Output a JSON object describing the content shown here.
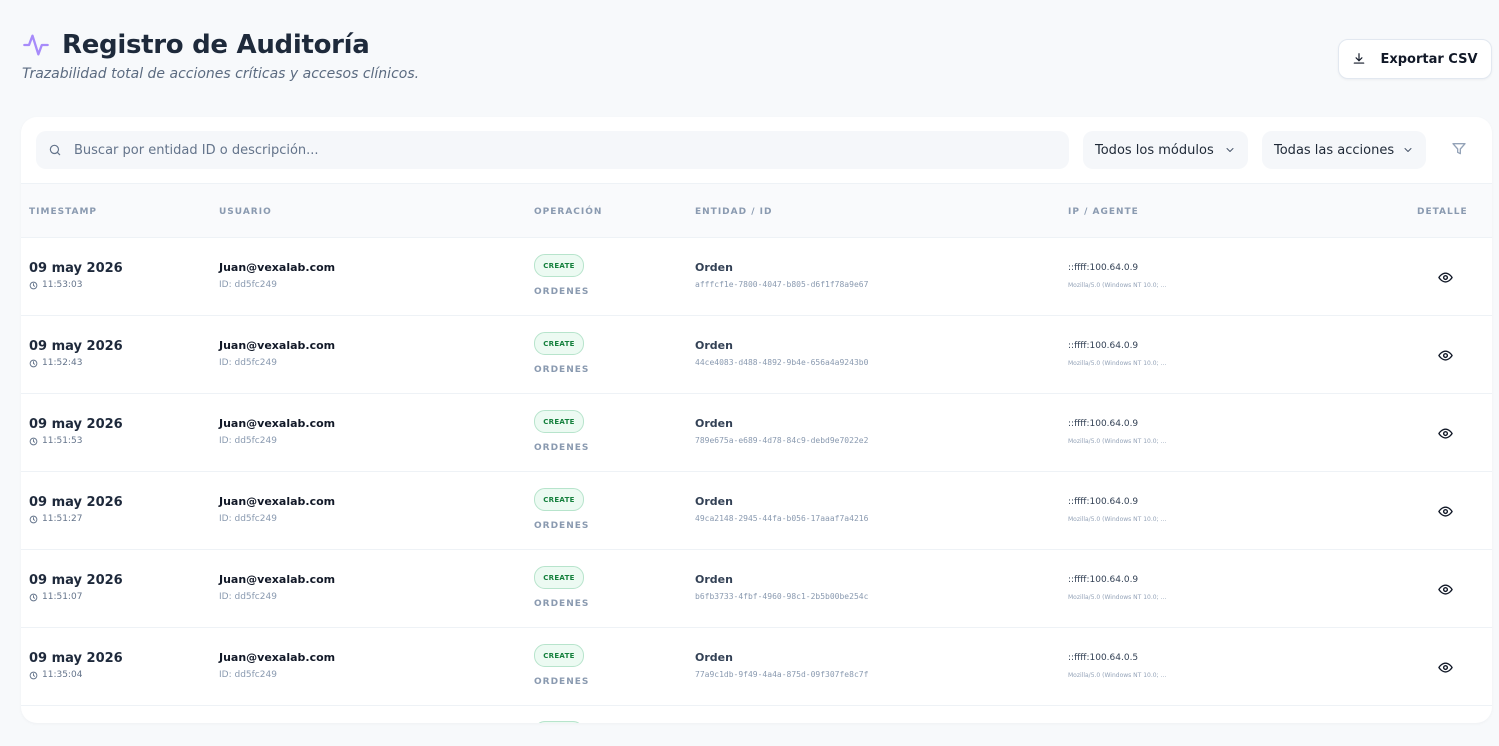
{
  "header": {
    "title": "Registro de Auditoría",
    "subtitle": "Trazabilidad total de acciones críticas y accesos clínicos.",
    "export_label": "Exportar CSV"
  },
  "toolbar": {
    "search_placeholder": "Buscar por entidad ID o descripción...",
    "module_filter": "Todos los módulos",
    "action_filter": "Todas las acciones"
  },
  "table": {
    "columns": {
      "timestamp": "TIMESTAMP",
      "user": "USUARIO",
      "operation": "OPERACIÓN",
      "entity": "ENTIDAD / ID",
      "ip": "IP / AGENTE",
      "detail": "DETALLE"
    },
    "rows": [
      {
        "date": "09 may 2026",
        "time": "11:53:03",
        "email": "Juan@vexalab.com",
        "user_id": "ID: dd5fc249",
        "operation": "CREATE",
        "module": "ORDENES",
        "entity": "Orden",
        "entity_id": "afffcf1e-7800-4047-b805-d6f1f78a9e67",
        "ip": "::ffff:100.64.0.9",
        "agent": "Mozilla/5.0 (Windows NT 10.0; ..."
      },
      {
        "date": "09 may 2026",
        "time": "11:52:43",
        "email": "Juan@vexalab.com",
        "user_id": "ID: dd5fc249",
        "operation": "CREATE",
        "module": "ORDENES",
        "entity": "Orden",
        "entity_id": "44ce4083-d488-4892-9b4e-656a4a9243b0",
        "ip": "::ffff:100.64.0.9",
        "agent": "Mozilla/5.0 (Windows NT 10.0; ..."
      },
      {
        "date": "09 may 2026",
        "time": "11:51:53",
        "email": "Juan@vexalab.com",
        "user_id": "ID: dd5fc249",
        "operation": "CREATE",
        "module": "ORDENES",
        "entity": "Orden",
        "entity_id": "789e675a-e689-4d78-84c9-debd9e7022e2",
        "ip": "::ffff:100.64.0.9",
        "agent": "Mozilla/5.0 (Windows NT 10.0; ..."
      },
      {
        "date": "09 may 2026",
        "time": "11:51:27",
        "email": "Juan@vexalab.com",
        "user_id": "ID: dd5fc249",
        "operation": "CREATE",
        "module": "ORDENES",
        "entity": "Orden",
        "entity_id": "49ca2148-2945-44fa-b056-17aaaf7a4216",
        "ip": "::ffff:100.64.0.9",
        "agent": "Mozilla/5.0 (Windows NT 10.0; ..."
      },
      {
        "date": "09 may 2026",
        "time": "11:51:07",
        "email": "Juan@vexalab.com",
        "user_id": "ID: dd5fc249",
        "operation": "CREATE",
        "module": "ORDENES",
        "entity": "Orden",
        "entity_id": "b6fb3733-4fbf-4960-98c1-2b5b00be254c",
        "ip": "::ffff:100.64.0.9",
        "agent": "Mozilla/5.0 (Windows NT 10.0; ..."
      },
      {
        "date": "09 may 2026",
        "time": "11:35:04",
        "email": "Juan@vexalab.com",
        "user_id": "ID: dd5fc249",
        "operation": "CREATE",
        "module": "ORDENES",
        "entity": "Orden",
        "entity_id": "77a9c1db-9f49-4a4a-875d-09f307fe8c7f",
        "ip": "::ffff:100.64.0.5",
        "agent": "Mozilla/5.0 (Windows NT 10.0; ..."
      }
    ]
  },
  "colors": {
    "accent": "#a78bfa",
    "badge_green": "#15803d"
  },
  "icons": [
    "activity-icon",
    "download-icon",
    "search-icon",
    "chevron-down-icon",
    "filter-icon",
    "clock-icon",
    "eye-icon"
  ]
}
